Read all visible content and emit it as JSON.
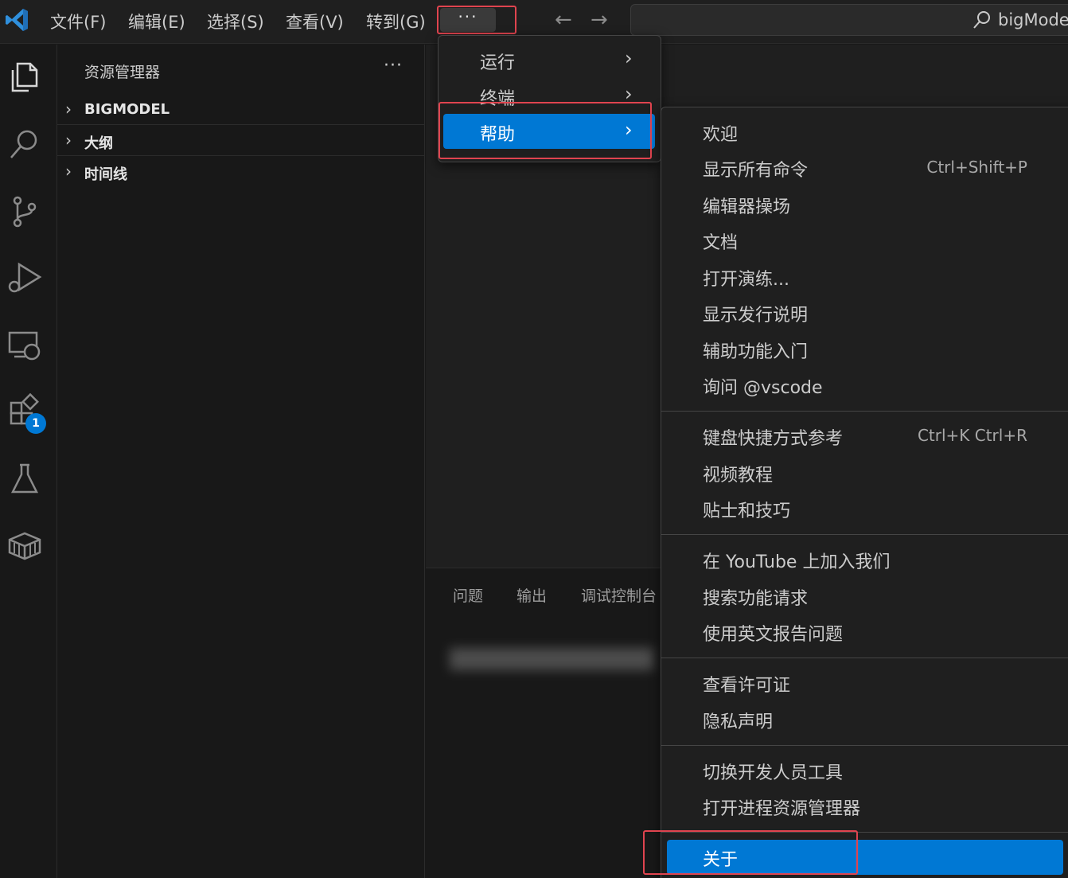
{
  "titlebar": {
    "menus": [
      "文件(F)",
      "编辑(E)",
      "选择(S)",
      "查看(V)",
      "转到(G)"
    ],
    "more_label": "···",
    "back_arrow": "←",
    "forward_arrow": "→",
    "search_text": "bigModel"
  },
  "activity_bar": {
    "icons": [
      "explorer-icon",
      "search-icon",
      "source-control-icon",
      "run-debug-icon",
      "remote-explorer-icon",
      "extensions-icon",
      "testing-icon",
      "containers-icon"
    ],
    "extensions_badge": "1"
  },
  "sidebar": {
    "title": "资源管理器",
    "more": "···",
    "sections": [
      {
        "label": "BIGMODEL"
      },
      {
        "label": "大纲"
      },
      {
        "label": "时间线"
      }
    ]
  },
  "panel": {
    "tabs": [
      "问题",
      "输出",
      "调试控制台"
    ]
  },
  "menu_overflow": {
    "items": [
      {
        "label": "运行",
        "submenu": true
      },
      {
        "label": "终端",
        "submenu": true
      },
      {
        "label": "帮助",
        "submenu": true,
        "active": true
      }
    ]
  },
  "menu_help": {
    "groups": [
      [
        {
          "label": "欢迎"
        },
        {
          "label": "显示所有命令",
          "shortcut": "Ctrl+Shift+P"
        },
        {
          "label": "编辑器操场"
        },
        {
          "label": "文档"
        },
        {
          "label": "打开演练..."
        },
        {
          "label": "显示发行说明"
        },
        {
          "label": "辅助功能入门"
        },
        {
          "label": "询问 @vscode"
        }
      ],
      [
        {
          "label": "键盘快捷方式参考",
          "shortcut": "Ctrl+K Ctrl+R"
        },
        {
          "label": "视频教程"
        },
        {
          "label": "贴士和技巧"
        }
      ],
      [
        {
          "label": "在 YouTube 上加入我们"
        },
        {
          "label": "搜索功能请求"
        },
        {
          "label": "使用英文报告问题"
        }
      ],
      [
        {
          "label": "查看许可证"
        },
        {
          "label": "隐私声明"
        }
      ],
      [
        {
          "label": "切换开发人员工具"
        },
        {
          "label": "打开进程资源管理器"
        }
      ],
      [
        {
          "label": "关于",
          "active": true
        }
      ]
    ]
  },
  "colors": {
    "accent": "#0078d4",
    "highlight_box": "#e0444f",
    "background": "#181818"
  }
}
